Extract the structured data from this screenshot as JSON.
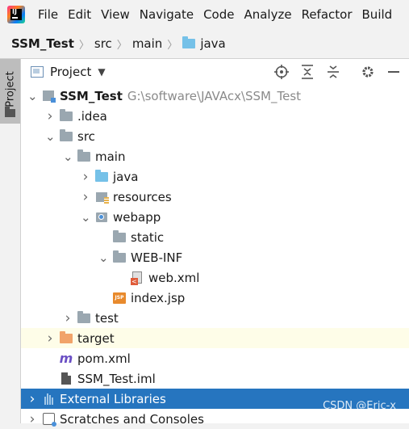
{
  "menu": [
    "File",
    "Edit",
    "View",
    "Navigate",
    "Code",
    "Analyze",
    "Refactor",
    "Build"
  ],
  "breadcrumb": [
    "SSM_Test",
    "src",
    "main",
    "java"
  ],
  "sidebar_tab": "Project",
  "panel": {
    "title": "Project"
  },
  "tree": [
    {
      "label": "SSM_Test",
      "hint": "G:\\software\\JAVAcx\\SSM_Test",
      "chevron": "down",
      "icon": "module-icon",
      "indent": 0
    },
    {
      "label": ".idea",
      "chevron": "right",
      "icon": "folder-icon",
      "indent": 1
    },
    {
      "label": "src",
      "chevron": "down",
      "icon": "folder-icon",
      "indent": 1
    },
    {
      "label": "main",
      "chevron": "down",
      "icon": "folder-icon",
      "indent": 2
    },
    {
      "label": "java",
      "chevron": "right",
      "icon": "source-folder-icon",
      "indent": 3
    },
    {
      "label": "resources",
      "chevron": "right",
      "icon": "resources-folder-icon",
      "indent": 3
    },
    {
      "label": "webapp",
      "chevron": "down",
      "icon": "webapp-folder-icon",
      "indent": 3
    },
    {
      "label": "static",
      "chevron": "",
      "icon": "folder-icon",
      "indent": 4
    },
    {
      "label": "WEB-INF",
      "chevron": "down",
      "icon": "folder-icon",
      "indent": 4
    },
    {
      "label": "web.xml",
      "chevron": "",
      "icon": "xml-file-icon",
      "indent": 5
    },
    {
      "label": "index.jsp",
      "chevron": "",
      "icon": "jsp-file-icon",
      "indent": 4
    },
    {
      "label": "test",
      "chevron": "right",
      "icon": "folder-icon",
      "indent": 2
    },
    {
      "label": "target",
      "chevron": "right",
      "icon": "excluded-folder-icon",
      "indent": 1
    },
    {
      "label": "pom.xml",
      "chevron": "",
      "icon": "maven-pom-icon",
      "indent": 1
    },
    {
      "label": "SSM_Test.iml",
      "chevron": "",
      "icon": "iml-file-icon",
      "indent": 1
    },
    {
      "label": "External Libraries",
      "chevron": "right",
      "icon": "library-icon",
      "indent": 0
    },
    {
      "label": "Scratches and Consoles",
      "chevron": "right",
      "icon": "scratch-icon",
      "indent": 0
    }
  ],
  "watermark": "CSDN @Eric-x",
  "colors": {
    "selection": "#2675bf",
    "excluded_highlight": "#fefde8",
    "source_folder": "#75c1e8",
    "excluded_folder": "#f1a36a"
  }
}
